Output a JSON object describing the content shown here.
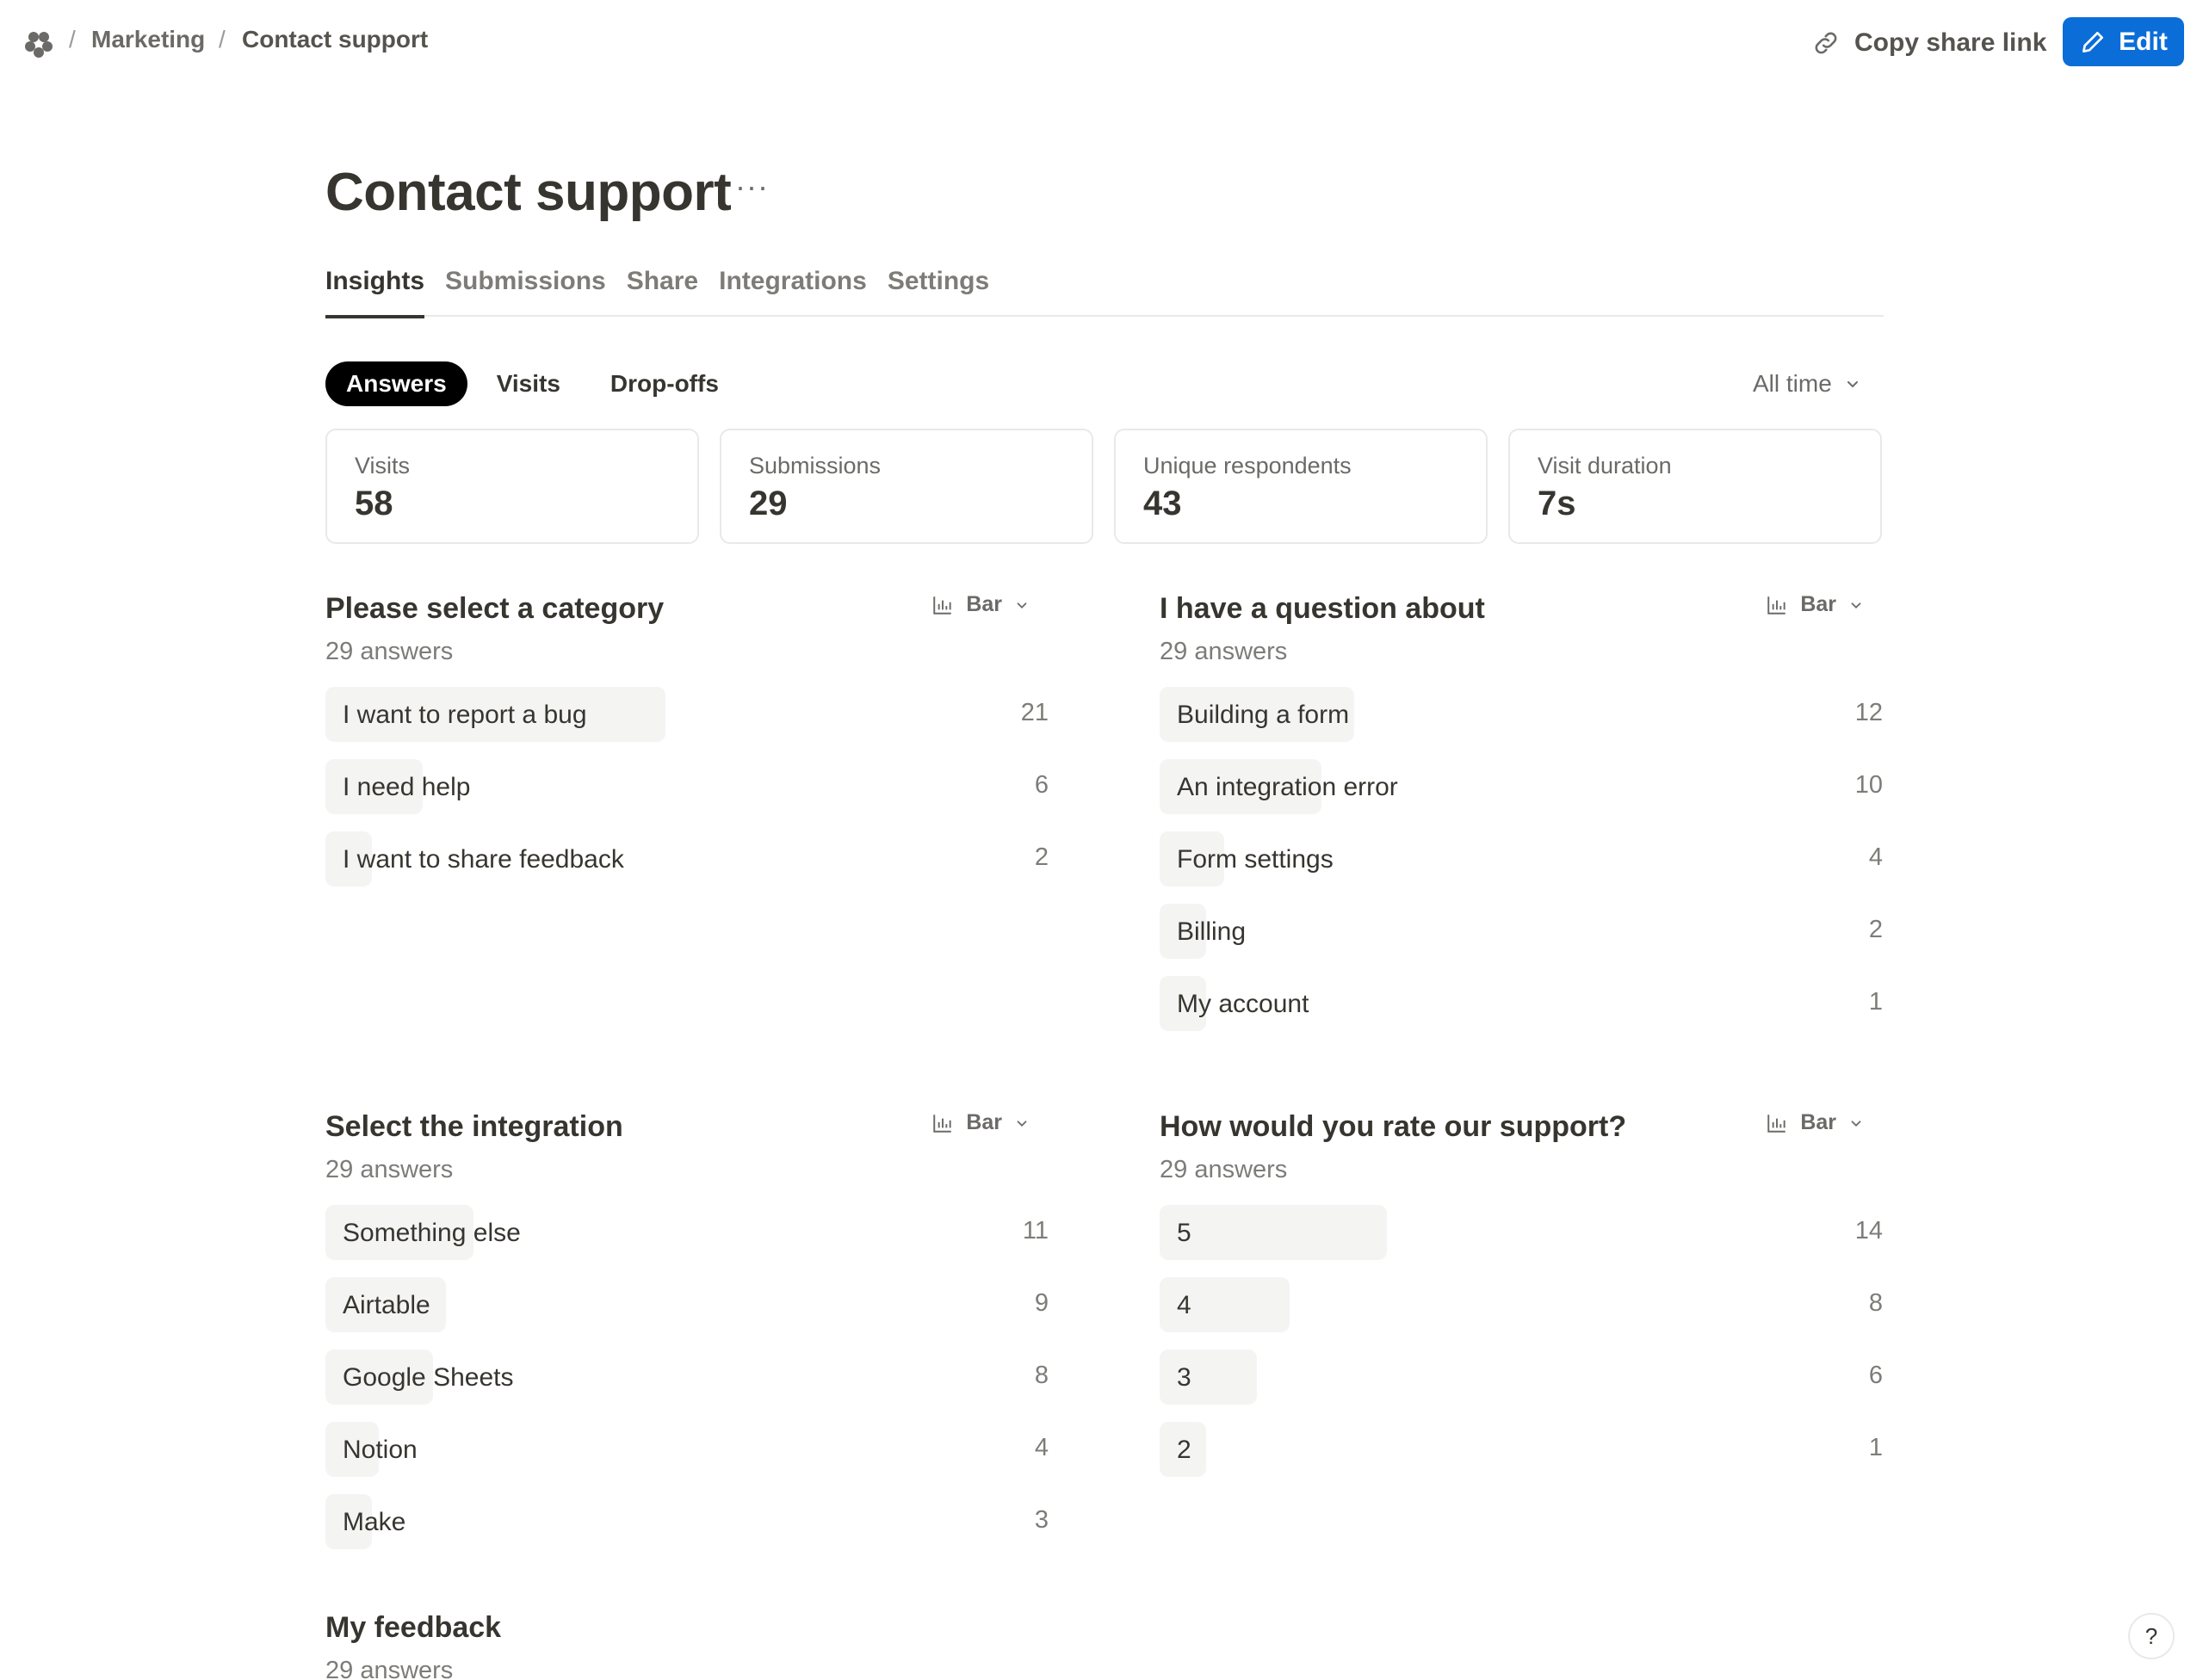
{
  "breadcrumb": {
    "separator": "/",
    "items": [
      "Marketing",
      "Contact support"
    ]
  },
  "header": {
    "copy_link_label": "Copy share link",
    "edit_label": "Edit"
  },
  "page": {
    "title": "Contact support",
    "more_label": "···"
  },
  "tabs": [
    "Insights",
    "Submissions",
    "Share",
    "Integrations",
    "Settings"
  ],
  "subtabs": [
    "Answers",
    "Visits",
    "Drop-offs"
  ],
  "time_filter": "All time",
  "stats": [
    {
      "label": "Visits",
      "value": "58"
    },
    {
      "label": "Submissions",
      "value": "29"
    },
    {
      "label": "Unique respondents",
      "value": "43"
    },
    {
      "label": "Visit duration",
      "value": "7s"
    }
  ],
  "questions": [
    {
      "title": "Please select a category",
      "count": "29 answers",
      "chart_type": "Bar",
      "rows": [
        {
          "label": "I want to report a bug",
          "value": 21
        },
        {
          "label": "I need help",
          "value": 6
        },
        {
          "label": "I want to share feedback",
          "value": 2
        }
      ]
    },
    {
      "title": "I have a question about",
      "count": "29 answers",
      "chart_type": "Bar",
      "rows": [
        {
          "label": "Building a form",
          "value": 12
        },
        {
          "label": "An integration error",
          "value": 10
        },
        {
          "label": "Form settings",
          "value": 4
        },
        {
          "label": "Billing",
          "value": 2
        },
        {
          "label": "My account",
          "value": 1
        }
      ]
    },
    {
      "title": "Select the integration",
      "count": "29 answers",
      "chart_type": "Bar",
      "rows": [
        {
          "label": "Something else",
          "value": 11
        },
        {
          "label": "Airtable",
          "value": 9
        },
        {
          "label": "Google Sheets",
          "value": 8
        },
        {
          "label": "Notion",
          "value": 4
        },
        {
          "label": "Make",
          "value": 3
        }
      ]
    },
    {
      "title": "How would you rate our support?",
      "count": "29 answers",
      "chart_type": "Bar",
      "rows": [
        {
          "label": "5",
          "value": 14
        },
        {
          "label": "4",
          "value": 8
        },
        {
          "label": "3",
          "value": 6
        },
        {
          "label": "2",
          "value": 1
        }
      ]
    },
    {
      "title": "My feedback",
      "count": "29 answers"
    }
  ],
  "help_label": "?",
  "colors": {
    "accent": "#0b6dd8",
    "bar": "#f4f4f3",
    "text": "#37352f"
  }
}
